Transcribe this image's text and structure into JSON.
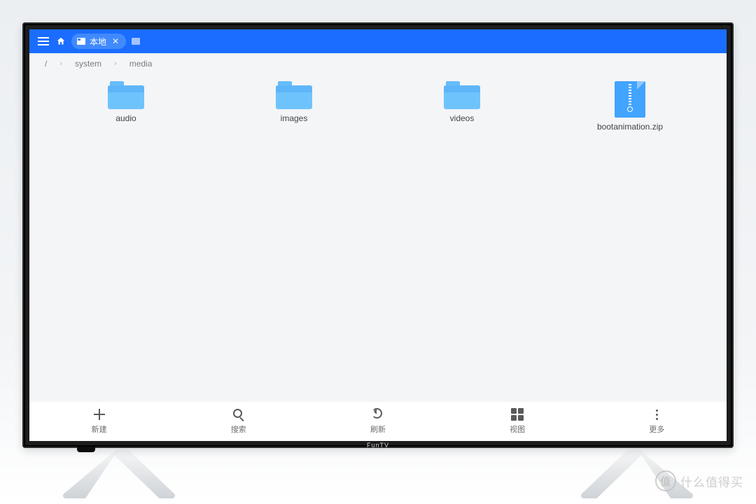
{
  "topbar": {
    "tab_label": "本地"
  },
  "breadcrumb": {
    "root": "/",
    "parts": [
      "system",
      "media"
    ]
  },
  "files": [
    {
      "name": "audio",
      "type": "folder"
    },
    {
      "name": "images",
      "type": "folder"
    },
    {
      "name": "videos",
      "type": "folder"
    },
    {
      "name": "bootanimation.zip",
      "type": "zip"
    }
  ],
  "toolbar": {
    "new": "新建",
    "search": "搜索",
    "refresh": "刷新",
    "view": "视图",
    "more": "更多"
  },
  "tv_brand": "FunTV",
  "watermark": {
    "badge": "值",
    "text": "什么值得买"
  }
}
